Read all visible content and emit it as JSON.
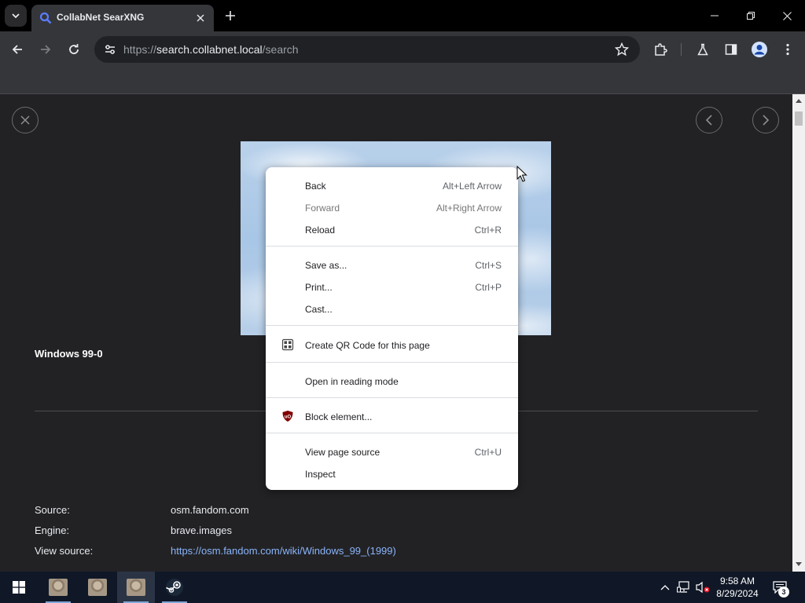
{
  "browser": {
    "tab_title": "CollabNet SearXNG",
    "url_scheme": "https://",
    "url_host": "search.collabnet.local",
    "url_path": "/search"
  },
  "page": {
    "image_title": "Windows 99-0",
    "details": [
      {
        "label": "Source:",
        "value": "osm.fandom.com",
        "is_link": false
      },
      {
        "label": "Engine:",
        "value": "brave.images",
        "is_link": false
      },
      {
        "label": "View source:",
        "value": "https://osm.fandom.com/wiki/Windows_99_(1999)",
        "is_link": true
      }
    ]
  },
  "context_menu": {
    "items": [
      {
        "label": "Back",
        "shortcut": "Alt+Left Arrow"
      },
      {
        "label": "Forward",
        "shortcut": "Alt+Right Arrow"
      },
      {
        "label": "Reload",
        "shortcut": "Ctrl+R"
      },
      {
        "label": "Save as...",
        "shortcut": "Ctrl+S"
      },
      {
        "label": "Print...",
        "shortcut": "Ctrl+P"
      },
      {
        "label": "Cast...",
        "shortcut": ""
      },
      {
        "label": "Create QR Code for this page",
        "shortcut": ""
      },
      {
        "label": "Open in reading mode",
        "shortcut": ""
      },
      {
        "label": "Block element...",
        "shortcut": ""
      },
      {
        "label": "View page source",
        "shortcut": "Ctrl+U"
      },
      {
        "label": "Inspect",
        "shortcut": ""
      }
    ]
  },
  "taskbar": {
    "time": "9:58 AM",
    "date": "8/29/2024",
    "notification_count": "3"
  },
  "colors": {
    "accent_link": "#8ab4f8",
    "ublock_red": "#800000",
    "favicon_blue": "#5b7cff"
  }
}
